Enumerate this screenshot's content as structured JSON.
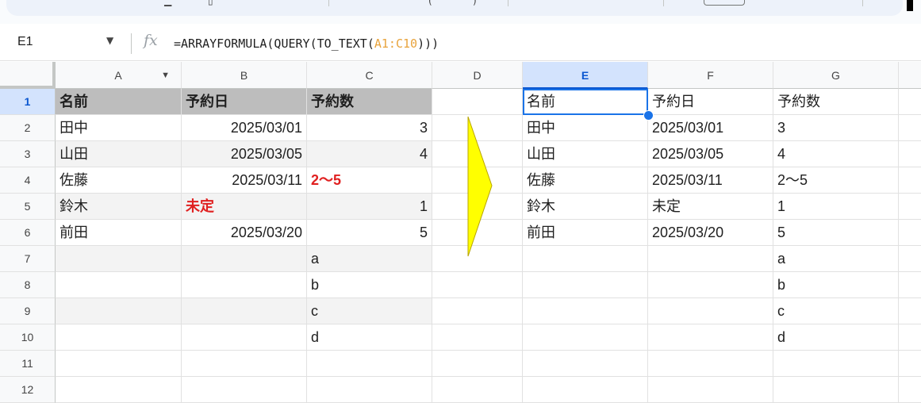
{
  "name_box": "E1",
  "formula": {
    "prefix": "=ARRAYFORMULA(QUERY(TO_TEXT(",
    "ref": "A1:C10",
    "suffix": ")))"
  },
  "fx_label": "fx",
  "columns": [
    "A",
    "B",
    "C",
    "D",
    "E",
    "F",
    "G"
  ],
  "rows": [
    "1",
    "2",
    "3",
    "4",
    "5",
    "6",
    "7",
    "8",
    "9",
    "10",
    "11",
    "12"
  ],
  "source": {
    "A": [
      "名前",
      "田中",
      "山田",
      "佐藤",
      "鈴木",
      "前田",
      "",
      "",
      "",
      ""
    ],
    "B": [
      "予約日",
      "2025/03/01",
      "2025/03/05",
      "2025/03/11",
      "未定",
      "2025/03/20",
      "",
      "",
      "",
      ""
    ],
    "C": [
      "予約数",
      "3",
      "4",
      "2〜5",
      "1",
      "5",
      "a",
      "b",
      "c",
      "d"
    ]
  },
  "result": {
    "E": [
      "名前",
      "田中",
      "山田",
      "佐藤",
      "鈴木",
      "前田",
      "",
      "",
      "",
      ""
    ],
    "F": [
      "予約日",
      "2025/03/01",
      "2025/03/05",
      "2025/03/11",
      "未定",
      "2025/03/20",
      "",
      "",
      "",
      ""
    ],
    "G": [
      "予約数",
      "3",
      "4",
      "2〜5",
      "1",
      "5",
      "a",
      "b",
      "c",
      "d"
    ]
  },
  "selected_cell": "E1",
  "colors": {
    "header_fill": "#bdbdbd",
    "band_fill": "#f3f3f3",
    "text_red": "#e02020",
    "selection_blue": "#1a73e8",
    "arrow_fill": "#ffff00",
    "formula_ref": "#e8a33c"
  },
  "icons": {
    "namebox_dropdown": "chevron-down-icon",
    "fx": "function-icon",
    "arrow": "right-arrow-shape"
  }
}
